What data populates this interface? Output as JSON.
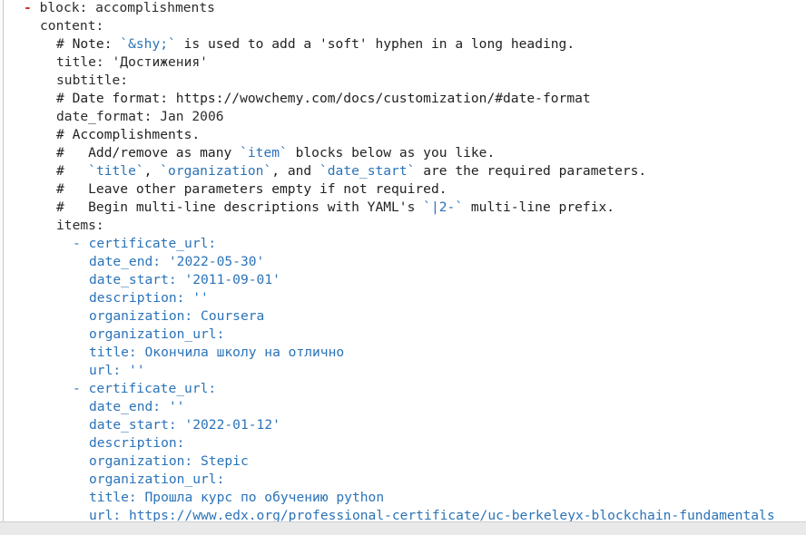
{
  "editor": {
    "lines": [
      {
        "indent": 26,
        "dash": "-",
        "key": "block:",
        "value": "accomplishments"
      },
      {
        "indent": 44,
        "key": "content:"
      },
      {
        "indent": 62,
        "comment": "# Note: ",
        "bt1": "`&shy;`",
        "rest": " is used to add a 'soft' hyphen in a long heading."
      },
      {
        "indent": 62,
        "key": "title:",
        "value": "'Достижения'"
      },
      {
        "indent": 62,
        "key": "subtitle:"
      },
      {
        "indent": 62,
        "comment": "# Date format: https://wowchemy.com/docs/customization/#date-format"
      },
      {
        "indent": 62,
        "key": "date_format:",
        "value": "Jan 2006"
      },
      {
        "indent": 62,
        "comment": "# Accomplishments."
      },
      {
        "indent": 62,
        "comment": "#   Add/remove as many ",
        "bt1": "`item`",
        "rest": " blocks below as you like."
      },
      {
        "indent": 62,
        "comment": "#   ",
        "bt1": "`title`",
        "mid1": ", ",
        "bt2": "`organization`",
        "mid2": ", and ",
        "bt3": "`date_start`",
        "rest": " are the required parameters."
      },
      {
        "indent": 62,
        "comment": "#   Leave other parameters empty if not required."
      },
      {
        "indent": 62,
        "comment": "#   Begin multi-line descriptions with YAML's ",
        "bt1": "`|2-`",
        "rest": " multi-line prefix."
      },
      {
        "indent": 62,
        "key": "items:"
      },
      {
        "indent": 80,
        "dash2": "-",
        "nkey": "certificate_url:"
      },
      {
        "indent": 98,
        "nkey": "date_end:",
        "nvalue": "'2022-05-30'"
      },
      {
        "indent": 98,
        "nkey": "date_start:",
        "nvalue": "'2011-09-01'"
      },
      {
        "indent": 98,
        "nkey": "description:",
        "nvalue": "''"
      },
      {
        "indent": 98,
        "nkey": "organization:",
        "nvalue": "Coursera"
      },
      {
        "indent": 98,
        "nkey": "organization_url:"
      },
      {
        "indent": 98,
        "nkey": "title:",
        "nvalue": "Окончила школу на отлично"
      },
      {
        "indent": 98,
        "nkey": "url:",
        "nvalue": "''"
      },
      {
        "indent": 80,
        "dash2": "-",
        "nkey": "certificate_url:"
      },
      {
        "indent": 98,
        "nkey": "date_end:",
        "nvalue": "''"
      },
      {
        "indent": 98,
        "nkey": "date_start:",
        "nvalue": "'2022-01-12'"
      },
      {
        "indent": 98,
        "nkey": "description:"
      },
      {
        "indent": 98,
        "nkey": "organization:",
        "nvalue": "Stepic"
      },
      {
        "indent": 98,
        "nkey": "organization_url:"
      },
      {
        "indent": 98,
        "nkey": "title:",
        "nvalue": "Прошла курс по обучению python"
      },
      {
        "indent": 98,
        "nkey": "url:",
        "nvalue": "https://www.edx.org/professional-certificate/uc-berkeleyx-blockchain-fundamentals"
      }
    ]
  }
}
